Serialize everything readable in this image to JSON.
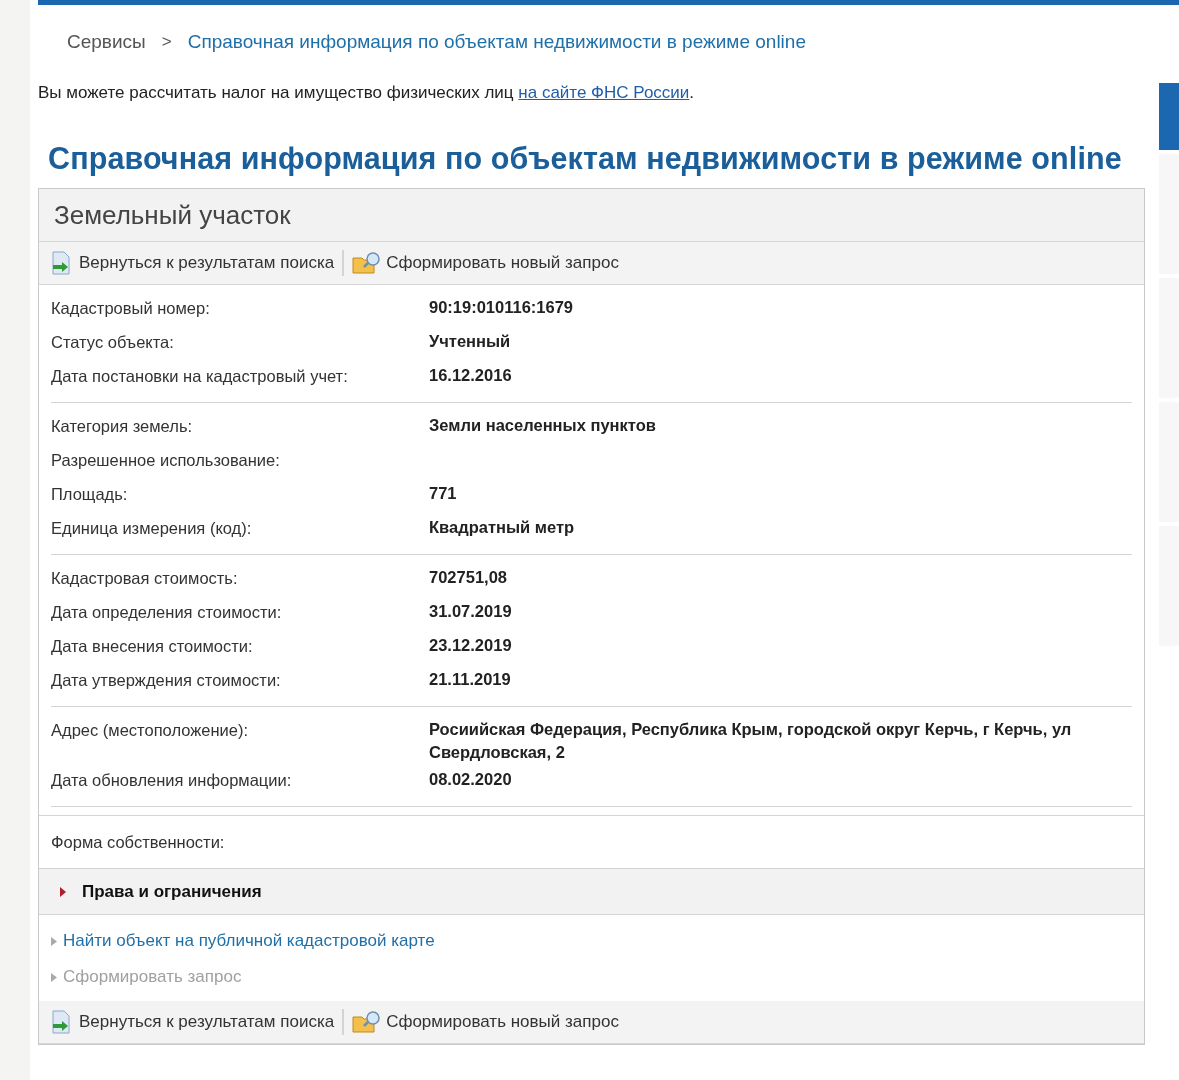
{
  "breadcrumb": {
    "items": [
      {
        "label": "Сервисы",
        "current": false
      },
      {
        "label": "Справочная информация по объектам недвижимости в режиме online",
        "current": true
      }
    ],
    "separator": ">"
  },
  "intro": {
    "text": "Вы можете рассчитать налог на имущество физических лиц ",
    "link": "на сайте ФНС России",
    "end": "."
  },
  "heading": "Справочная информация по объектам недвижимости в режиме online",
  "panel": {
    "title": "Земельный участок",
    "toolbar_top": [
      {
        "kind": "back",
        "label": "Вернуться к результатам поиска"
      },
      {
        "kind": "new",
        "label": "Сформировать новый запрос"
      }
    ],
    "groups": [
      {
        "rows": [
          {
            "label": "Кадастровый номер:",
            "value": "90:19:010116:1679"
          },
          {
            "label": "Статус объекта:",
            "value": "Учтенный"
          },
          {
            "label": "Дата постановки на кадастровый учет:",
            "value": "16.12.2016"
          }
        ]
      },
      {
        "rows": [
          {
            "label": "Категория земель:",
            "value": "Земли населенных пунктов"
          },
          {
            "label": "Разрешенное использование:"
          },
          {
            "label": "Площадь:",
            "value": "771"
          },
          {
            "label": "Единица измерения (код):",
            "value": "Квадратный метр"
          }
        ]
      },
      {
        "rows": [
          {
            "label": "Кадастровая стоимость:",
            "value": "702751,08"
          },
          {
            "label": "Дата определения стоимости:",
            "value": "31.07.2019"
          },
          {
            "label": "Дата внесения стоимости:",
            "value": "23.12.2019"
          },
          {
            "label": "Дата утверждения стоимости:",
            "value": "21.11.2019"
          }
        ]
      },
      {
        "rows": [
          {
            "label": "Адрес (местоположение):",
            "value": "Росиийская Федерация, Республика Крым, городской округ Керчь, г Керчь, ул Свердловская, 2"
          },
          {
            "label": "Дата обновления информации:",
            "value": "08.02.2020"
          }
        ]
      }
    ],
    "ownership": {
      "label": "Форма собственности:"
    },
    "rights": {
      "label": "Права и ограничения",
      "expanded": false
    },
    "links": [
      {
        "label": "Найти объект на публичной кадастровой карте",
        "disabled": false
      },
      {
        "label": "Сформировать запрос",
        "disabled": true
      }
    ],
    "toolbar_bottom": [
      {
        "kind": "back",
        "label": "Вернуться к результатам поиска"
      },
      {
        "kind": "new",
        "label": "Сформировать новый запрос"
      }
    ]
  }
}
